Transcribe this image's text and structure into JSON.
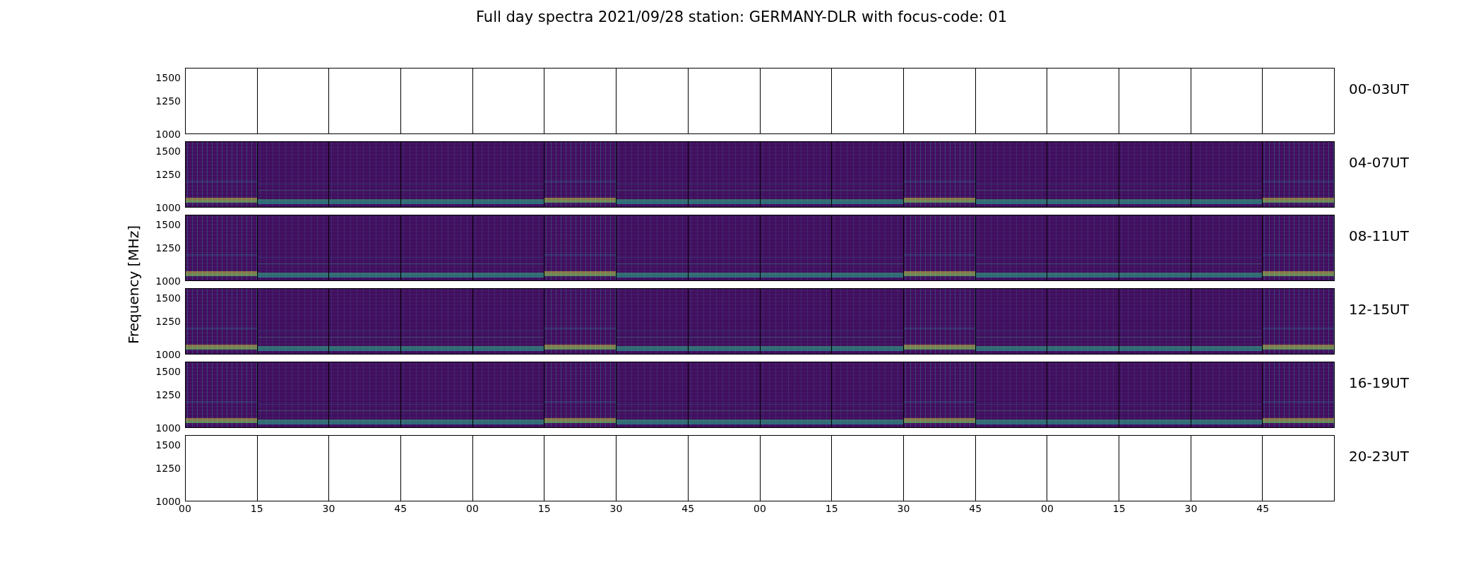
{
  "title": "Full day spectra 2021/09/28 station: GERMANY-DLR with focus-code: 01",
  "ylabel": "Frequency [MHz]",
  "rows": [
    {
      "label": "00-03UT",
      "kind": "empty",
      "yticks": [
        "1500",
        "1250",
        "1000"
      ]
    },
    {
      "label": "04-07UT",
      "kind": "spectrum",
      "yticks": [
        "1500",
        "1250",
        "1000"
      ]
    },
    {
      "label": "08-11UT",
      "kind": "spectrum",
      "yticks": [
        "1500",
        "1250",
        "1000"
      ]
    },
    {
      "label": "12-15UT",
      "kind": "spectrum",
      "yticks": [
        "1500",
        "1250",
        "1000"
      ]
    },
    {
      "label": "16-19UT",
      "kind": "spectrum",
      "yticks": [
        "1500",
        "1250",
        "1000"
      ]
    },
    {
      "label": "20-23UT",
      "kind": "empty",
      "yticks": [
        "1500",
        "1250",
        "1000"
      ]
    }
  ],
  "xticks": [
    "00",
    "15",
    "30",
    "45",
    "00",
    "15",
    "30",
    "45",
    "00",
    "15",
    "30",
    "45",
    "00",
    "15",
    "30",
    "45"
  ]
}
